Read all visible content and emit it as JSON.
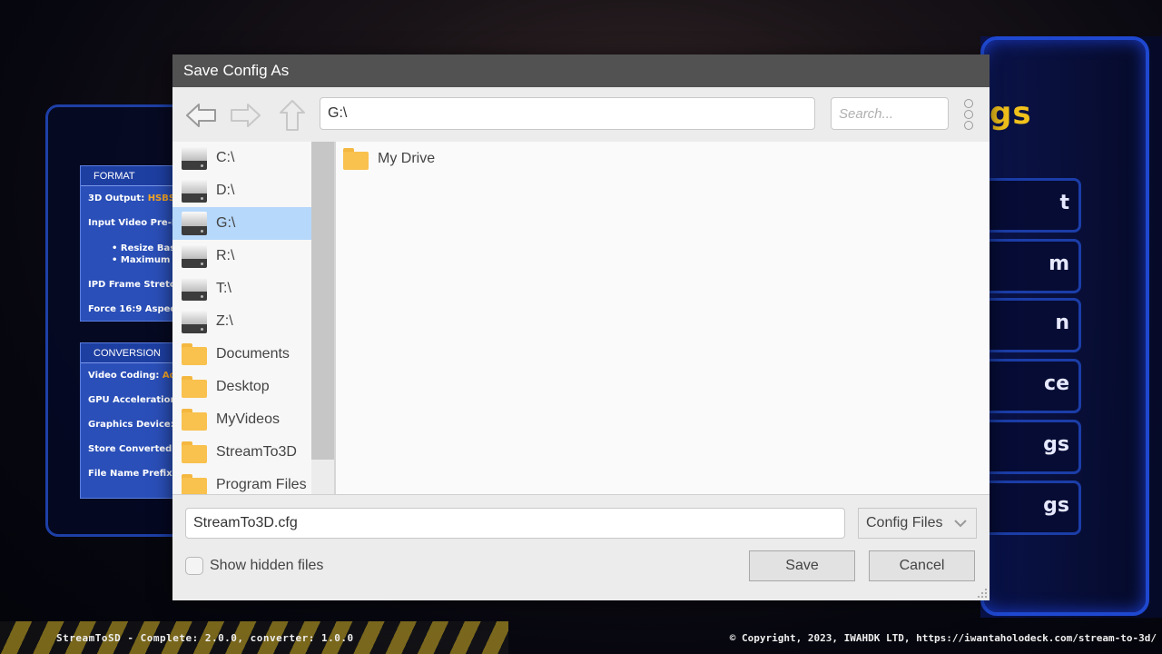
{
  "background": {
    "title_fragment": "gs",
    "menu_fragments": [
      "t",
      "m",
      "n",
      "ce",
      "gs",
      "gs"
    ],
    "format_section": {
      "header": "FORMAT",
      "rows": [
        {
          "label": "3D Output: ",
          "value": "HSBS"
        },
        {
          "label": "Input Video Pre-P",
          "value": ""
        }
      ],
      "subrows": [
        "• Resize Bas",
        "• Maximum V"
      ],
      "rows2": [
        {
          "label": "IPD Frame Stretc",
          "value": ""
        },
        {
          "label": "Force 16:9 Aspec",
          "value": ""
        }
      ]
    },
    "conversion_section": {
      "header": "CONVERSION",
      "rows": [
        {
          "label": "Video Coding: ",
          "value": "Adv"
        },
        {
          "label": "GPU Acceleration",
          "value": ""
        },
        {
          "label": "Graphics Device:",
          "value": ""
        },
        {
          "label": "Store Converted V",
          "value": ""
        },
        {
          "label": "File Name Prefix:",
          "value": ""
        }
      ]
    },
    "footer_left": "StreamToSD - Complete: 2.0.0, converter: 1.0.0",
    "footer_right": "© Copyright, 2023, IWAHDK LTD, https://iwantaholodeck.com/stream-to-3d/"
  },
  "dialog": {
    "title": "Save Config As",
    "path_value": "G:\\",
    "search_placeholder": "Search...",
    "sidebar": [
      {
        "label": "C:\\",
        "icon": "drive-icon",
        "selected": false
      },
      {
        "label": "D:\\",
        "icon": "drive-icon",
        "selected": false
      },
      {
        "label": "G:\\",
        "icon": "drive-icon",
        "selected": true
      },
      {
        "label": "R:\\",
        "icon": "drive-icon",
        "selected": false
      },
      {
        "label": "T:\\",
        "icon": "drive-icon",
        "selected": false
      },
      {
        "label": "Z:\\",
        "icon": "drive-icon",
        "selected": false
      },
      {
        "label": "Documents",
        "icon": "folder-icon",
        "selected": false
      },
      {
        "label": "Desktop",
        "icon": "folder-icon",
        "selected": false
      },
      {
        "label": "MyVideos",
        "icon": "folder-icon",
        "selected": false
      },
      {
        "label": "StreamTo3D",
        "icon": "folder-icon",
        "selected": false
      },
      {
        "label": "Program Files",
        "icon": "folder-icon",
        "selected": false
      }
    ],
    "files": [
      {
        "label": "My Drive",
        "icon": "folder-icon"
      }
    ],
    "filename_value": "StreamTo3D.cfg",
    "filter_selected": "Config Files",
    "show_hidden_label": "Show hidden files",
    "show_hidden_checked": false,
    "save_label": "Save",
    "cancel_label": "Cancel"
  }
}
